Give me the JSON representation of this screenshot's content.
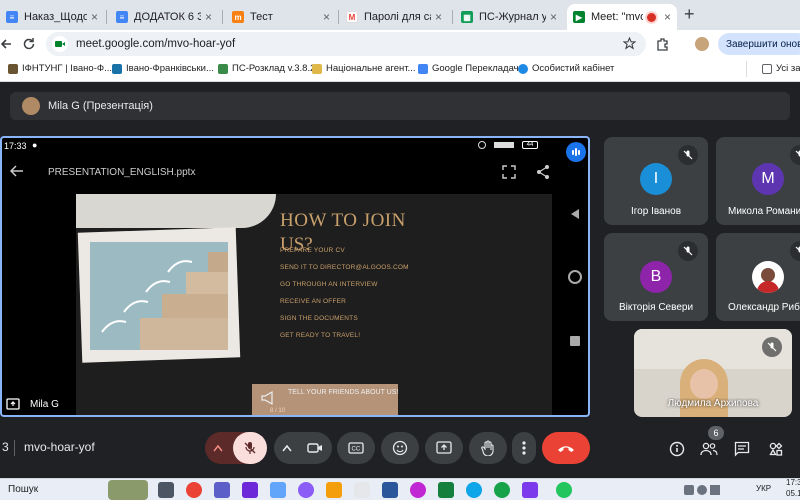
{
  "browser": {
    "tabs": [
      {
        "title": "Наказ_Щодо поді",
        "icon": "docs-icon"
      },
      {
        "title": "ДОДАТОК 6 Заоч",
        "icon": "docs-icon"
      },
      {
        "title": "Тест",
        "icon": "moodle-icon"
      },
      {
        "title": "Паролі для самор",
        "icon": "gmail-icon"
      },
      {
        "title": "ПС-Журнал успіш",
        "icon": "sheets-icon"
      },
      {
        "title": "Meet: \"mvo-h",
        "icon": "meet-icon"
      }
    ],
    "new_tab_symbol": "+",
    "close_symbol": "×",
    "address": "meet.google.com/mvo-hoar-yof",
    "finish_update_label": "Завершити оновлен",
    "bookmarks": [
      "ІФНТУНГ | Івано-Ф...",
      "Івано-Франківськи...",
      "ПС-Розклад v.3.8.2",
      "Національне агент...",
      "Google Перекладач",
      "Особистий кабінет"
    ],
    "all_bookmarks_label": "Усі закл"
  },
  "meet": {
    "presenter_label": "Mila G (Презентація)",
    "presentation_owner": "Mila G",
    "phone": {
      "time": "17:33",
      "battery": "44",
      "file_name": "PRESENTATION_ENGLISH.pptx"
    },
    "slide": {
      "title_line1": "HOW TO JOIN",
      "title_line2": "US?",
      "items": [
        "PREPARE YOUR CV",
        "SEND IT TO DIRECTOR@ALGOOS.COM",
        "GO THROUGH AN INTERVIEW",
        "RECEIVE AN OFFER",
        "SIGN THE DOCUMENTS",
        "GET READY TO TRAVEL!"
      ],
      "cta": "TELL YOUR FRIENDS ABOUT US!",
      "page_indicator": "8 / 10"
    },
    "participants": [
      {
        "name": "Ігор Іванов",
        "initial": "І",
        "color": "#1a8fd8"
      },
      {
        "name": "Микола Романи",
        "initial": "M",
        "color": "#5e35b1"
      },
      {
        "name": "Вікторія Севери",
        "initial": "В",
        "color": "#8e24aa"
      },
      {
        "name": "Олександр Риб",
        "initial": "",
        "color": "#ffffff"
      },
      {
        "name": "Людмила Архипова",
        "initial": "",
        "color": ""
      }
    ],
    "meeting_number_prefix": "3",
    "meeting_code": "mvo-hoar-yof",
    "people_count": "6",
    "controls": {
      "mic": "mic-off-icon",
      "camera": "camera-icon",
      "captions": "captions-icon",
      "emoji": "emoji-icon",
      "present": "present-icon",
      "raise_hand": "hand-icon",
      "more": "more-vert-icon",
      "end_call": "end-call-icon",
      "info": "info-icon",
      "people": "people-icon",
      "chat": "chat-icon",
      "activities": "activities-icon"
    }
  },
  "taskbar": {
    "search_label": "Пошук",
    "time": "17:3",
    "date": "05.10.2",
    "language": "УКР"
  }
}
